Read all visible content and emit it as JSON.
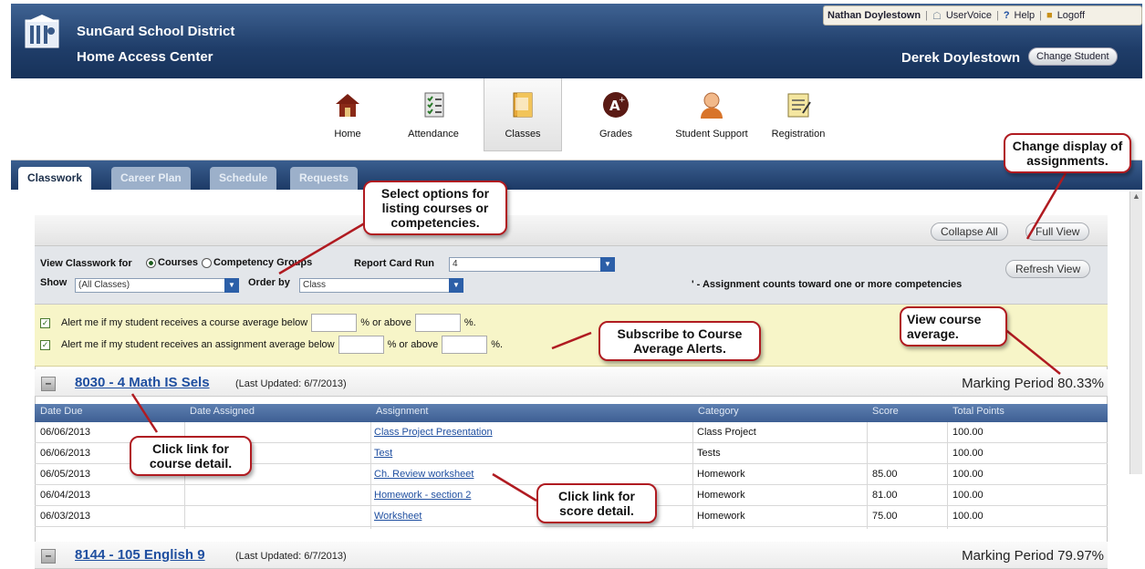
{
  "header": {
    "district": "SunGard School District",
    "app_name": "Home Access Center",
    "user": "Nathan Doylestown",
    "uservoice": "UserVoice",
    "help": "Help",
    "logoff": "Logoff",
    "student_name": "Derek Doylestown",
    "change_student": "Change Student"
  },
  "nav": {
    "home": "Home",
    "attendance": "Attendance",
    "classes": "Classes",
    "grades": "Grades",
    "student_support": "Student Support",
    "registration": "Registration"
  },
  "tabs": {
    "classwork": "Classwork",
    "career_plan": "Career Plan",
    "schedule": "Schedule",
    "requests": "Requests"
  },
  "toolbar": {
    "collapse_all": "Collapse All",
    "full_view": "Full View",
    "refresh_view": "Refresh View"
  },
  "filters": {
    "view_for": "View Classwork for",
    "courses": "Courses",
    "competency_groups": "Competency Groups",
    "report_card_run": "Report Card Run",
    "report_card_value": "4",
    "show": "Show",
    "show_value": "(All Classes)",
    "order_by": "Order by",
    "order_value": "Class",
    "competency_note": "' - Assignment counts toward one or more competencies"
  },
  "alerts": {
    "course_pre": "Alert me if my student receives a course average below",
    "course_mid": "% or above",
    "course_end": "%.",
    "assign_pre": "Alert me if my student receives an assignment average below",
    "assign_mid": "% or above",
    "assign_end": "%."
  },
  "courses": [
    {
      "name": "8030 - 4 Math IS Sels",
      "updated": "(Last Updated: 6/7/2013)",
      "mp": "Marking Period 80.33%"
    },
    {
      "name": "8144 - 105 English 9",
      "updated": "(Last Updated: 6/7/2013)",
      "mp": "Marking Period 79.97%"
    }
  ],
  "table": {
    "headers": [
      "Date Due",
      "Date Assigned",
      "Assignment",
      "Category",
      "Score",
      "Total Points"
    ],
    "rows": [
      {
        "due": "06/06/2013",
        "assigned": "",
        "assignment": "Class Project Presentation",
        "category": "Class Project",
        "score": "",
        "total": "100.00"
      },
      {
        "due": "06/06/2013",
        "assigned": "",
        "assignment": "Test",
        "category": "Tests",
        "score": "",
        "total": "100.00"
      },
      {
        "due": "06/05/2013",
        "assigned": "",
        "assignment": "Ch. Review worksheet",
        "category": "Homework",
        "score": "85.00",
        "total": "100.00"
      },
      {
        "due": "06/04/2013",
        "assigned": "",
        "assignment": "Homework - section 2",
        "category": "Homework",
        "score": "81.00",
        "total": "100.00"
      },
      {
        "due": "06/03/2013",
        "assigned": "",
        "assignment": "Worksheet",
        "category": "Homework",
        "score": "75.00",
        "total": "100.00"
      }
    ]
  },
  "callouts": {
    "display": "Change display of assignments.",
    "options": "Select options for listing courses or competencies.",
    "alerts": "Subscribe to Course Average Alerts.",
    "average": "View course average.",
    "course_detail": "Click link for course detail.",
    "score_detail": "Click link for score detail."
  }
}
